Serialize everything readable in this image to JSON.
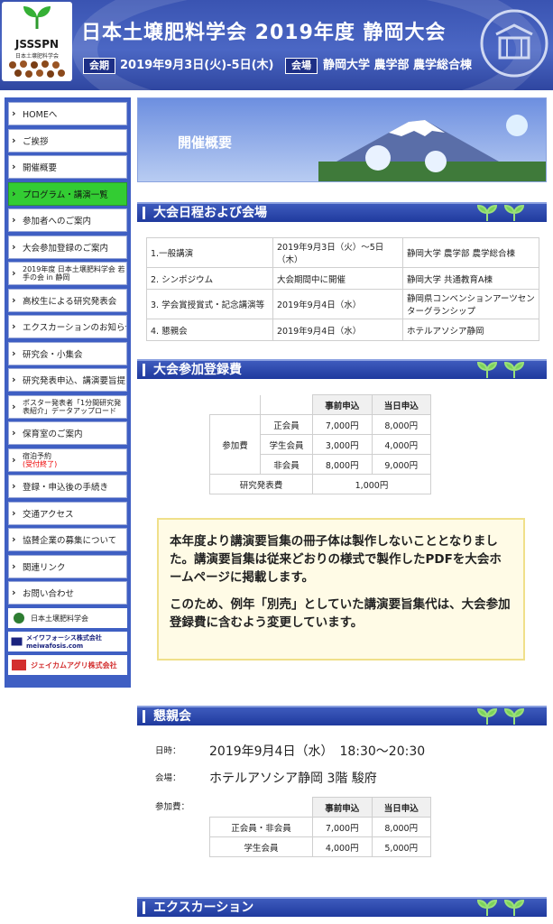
{
  "header": {
    "logo_text": "JSSSPN",
    "logo_sub": "日本土壌肥料学会",
    "title": "日本土壌肥料学会 2019年度 静岡大会",
    "period_label": "会期",
    "period_value": "2019年9月3日(火)-5日(木)",
    "venue_label": "会場",
    "venue_value": "静岡大学 農学部 農学総合棟"
  },
  "sidebar": {
    "items": [
      {
        "label": "HOMEへ"
      },
      {
        "label": "ご挨拶"
      },
      {
        "label": "開催概要"
      },
      {
        "label": "プログラム・講演一覧"
      },
      {
        "label": "参加者へのご案内"
      },
      {
        "label": "大会参加登録のご案内"
      },
      {
        "label": "2019年度 日本土壌肥料学会 若手の会 in 静岡"
      },
      {
        "label": "高校生による研究発表会"
      },
      {
        "label": "エクスカーションのお知らせ"
      },
      {
        "label": "研究会・小集会"
      },
      {
        "label": "研究発表申込、講演要旨提出"
      },
      {
        "label": "ポスター発表者「1分間研究発表紹介」データアップロード"
      },
      {
        "label": "保育室のご案内"
      },
      {
        "label": "宿泊予約",
        "sub": "(受付終了)"
      },
      {
        "label": "登録・申込後の手続き"
      },
      {
        "label": "交通アクセス"
      },
      {
        "label": "協賛企業の募集について"
      },
      {
        "label": "関連リンク"
      },
      {
        "label": "お問い合わせ"
      }
    ],
    "banners": [
      {
        "label": "日本土壌肥料学会",
        "color": "#2e7d32"
      },
      {
        "label": "メイワフォーシス株式会社 meiwafosis.com",
        "color": "#1a237e"
      },
      {
        "label": "ジェイカムアグリ株式会社",
        "color": "#d32f2f"
      }
    ]
  },
  "hero": {
    "title": "開催概要"
  },
  "sections": {
    "schedule": "大会日程および会場",
    "fees": "大会参加登録費",
    "party": "懇親会",
    "excursion": "エクスカーション"
  },
  "schedule_rows": [
    {
      "name": "1.一般講演",
      "date": "2019年9月3日（火）〜5日（木）",
      "place": "静岡大学 農学部 農学総合棟"
    },
    {
      "name": "2. シンポジウム",
      "date": "大会期間中に開催",
      "place": "静岡大学 共通教育A棟"
    },
    {
      "name": "3. 学会賞授賞式・記念講演等",
      "date": "2019年9月4日（水）",
      "place": "静岡県コンベンションアーツセンターグランシップ"
    },
    {
      "name": "4. 懇親会",
      "date": "2019年9月4日（水）",
      "place": "ホテルアソシア静岡"
    }
  ],
  "fee_table": {
    "col_early": "事前申込",
    "col_onsite": "当日申込",
    "group": "参加費",
    "rows": [
      {
        "type": "正会員",
        "early": "7,000円",
        "onsite": "8,000円"
      },
      {
        "type": "学生会員",
        "early": "3,000円",
        "onsite": "4,000円"
      },
      {
        "type": "非会員",
        "early": "8,000円",
        "onsite": "9,000円"
      }
    ],
    "research_label": "研究発表費",
    "research_fee": "1,000円"
  },
  "notice": {
    "p1": "本年度より講演要旨集の冊子体は製作しないこととなりました。講演要旨集は従来どおりの様式で製作したPDFを大会ホームページに掲載します。",
    "p2": "このため、例年「別売」としていた講演要旨集代は、大会参加登録費に含むよう変更しています。"
  },
  "party": {
    "date_label": "日時：",
    "date_value": "2019年9月4日（水）　18:30〜20:30",
    "venue_label": "会場：",
    "venue_value": "ホテルアソシア静岡 3階 駿府",
    "fee_label": "参加費：",
    "col_early": "事前申込",
    "col_onsite": "当日申込",
    "rows": [
      {
        "type": "正会員・非会員",
        "early": "7,000円",
        "onsite": "8,000円"
      },
      {
        "type": "学生会員",
        "early": "4,000円",
        "onsite": "5,000円"
      }
    ]
  },
  "colors": {
    "nav_active": "#33cc33",
    "accent_blue": "#3f5fc3"
  }
}
